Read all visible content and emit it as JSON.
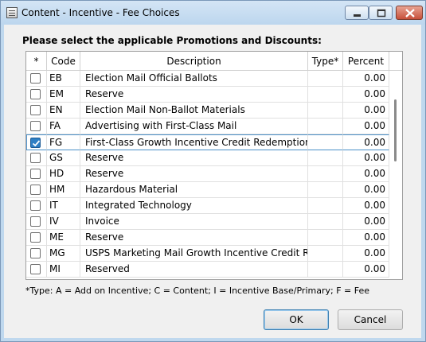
{
  "window": {
    "title": "Content - Incentive - Fee Choices"
  },
  "prompt": "Please select the applicable Promotions and Discounts:",
  "table": {
    "headers": {
      "check": "*",
      "code": "Code",
      "description": "Description",
      "type": "Type*",
      "percent": "Percent"
    },
    "rows": [
      {
        "checked": false,
        "code": "EB",
        "description": "Election Mail Official Ballots",
        "type": "",
        "percent": "0.00"
      },
      {
        "checked": false,
        "code": "EM",
        "description": "Reserve",
        "type": "",
        "percent": "0.00"
      },
      {
        "checked": false,
        "code": "EN",
        "description": "Election Mail Non-Ballot Materials",
        "type": "",
        "percent": "0.00"
      },
      {
        "checked": false,
        "code": "FA",
        "description": "Advertising with First-Class Mail",
        "type": "",
        "percent": "0.00"
      },
      {
        "checked": true,
        "code": "FG",
        "description": "First-Class Growth Incentive Credit Redemption",
        "type": "",
        "percent": "0.00"
      },
      {
        "checked": false,
        "code": "GS",
        "description": "Reserve",
        "type": "",
        "percent": "0.00"
      },
      {
        "checked": false,
        "code": "HD",
        "description": "Reserve",
        "type": "",
        "percent": "0.00"
      },
      {
        "checked": false,
        "code": "HM",
        "description": "Hazardous Material",
        "type": "",
        "percent": "0.00"
      },
      {
        "checked": false,
        "code": "IT",
        "description": "Integrated Technology",
        "type": "",
        "percent": "0.00"
      },
      {
        "checked": false,
        "code": "IV",
        "description": "Invoice",
        "type": "",
        "percent": "0.00"
      },
      {
        "checked": false,
        "code": "ME",
        "description": "Reserve",
        "type": "",
        "percent": "0.00"
      },
      {
        "checked": false,
        "code": "MG",
        "description": "USPS Marketing Mail Growth Incentive Credit Re",
        "type": "",
        "percent": "0.00"
      },
      {
        "checked": false,
        "code": "MI",
        "description": "Reserved",
        "type": "",
        "percent": "0.00"
      }
    ]
  },
  "legend": "*Type: A = Add on Incentive; C = Content; I = Incentive Base/Primary; F = Fee",
  "buttons": {
    "ok": "OK",
    "cancel": "Cancel"
  }
}
